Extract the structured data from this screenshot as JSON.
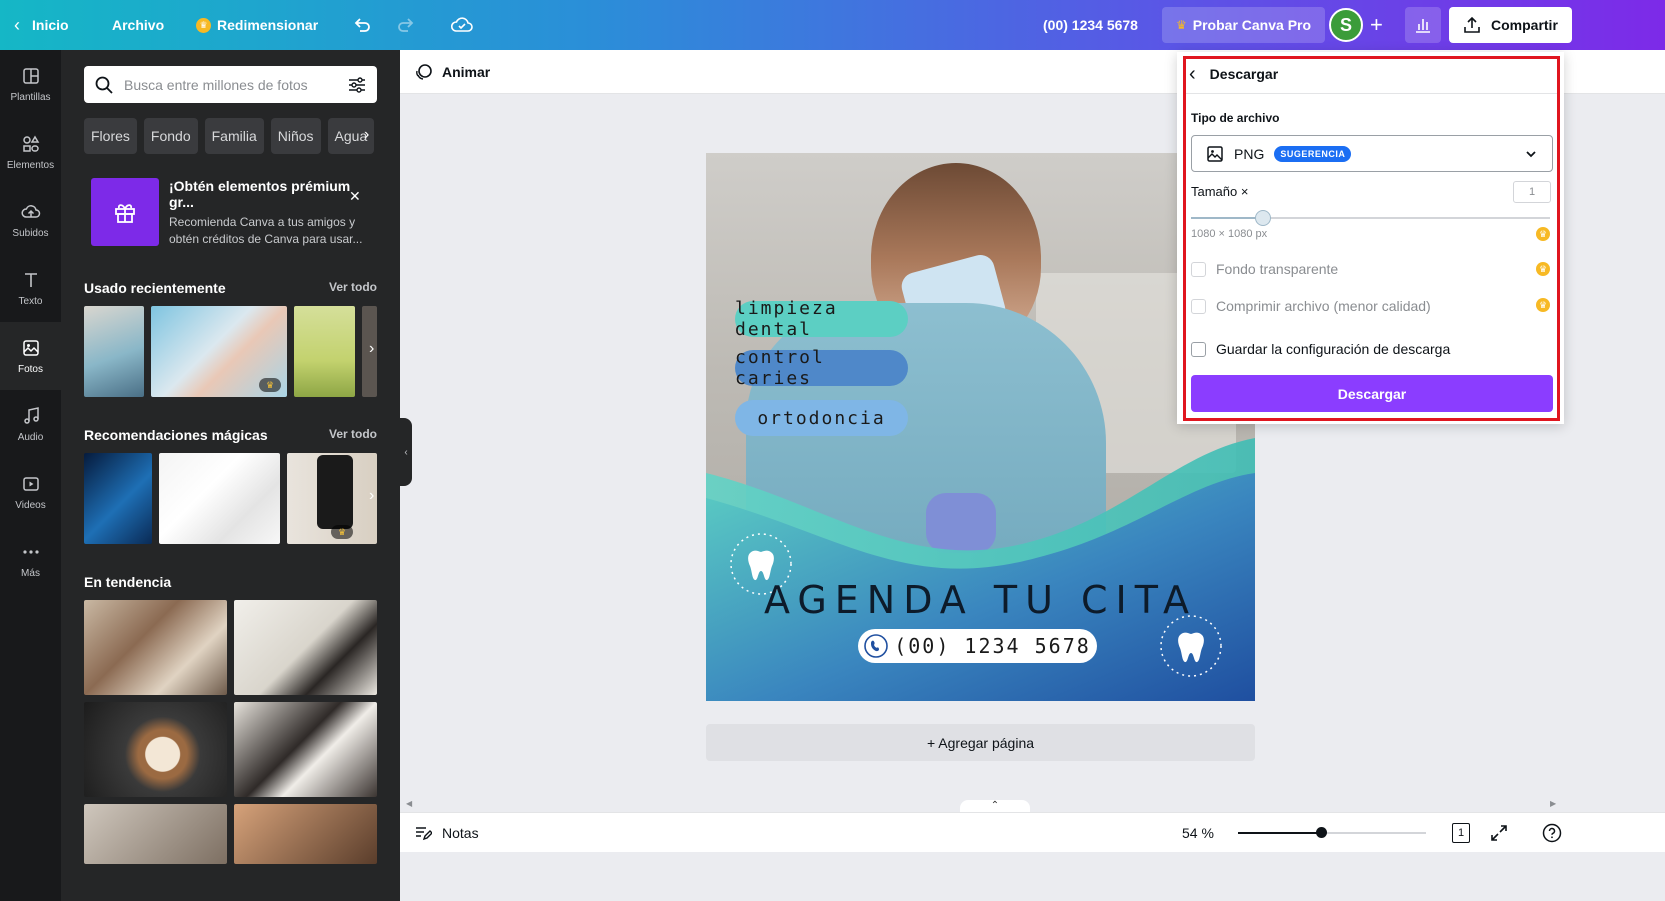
{
  "topbar": {
    "home": "Inicio",
    "file": "Archivo",
    "resize": "Redimensionar",
    "phone": "(00) 1234 5678",
    "try_pro": "Probar Canva Pro",
    "avatar_letter": "S",
    "share": "Compartir",
    "gradient_start": "#15b7c6",
    "gradient_end": "#7d2ae8"
  },
  "rail": {
    "items": [
      {
        "label": "Plantillas",
        "icon": "templates-icon"
      },
      {
        "label": "Elementos",
        "icon": "elements-icon"
      },
      {
        "label": "Subidos",
        "icon": "upload-cloud-icon"
      },
      {
        "label": "Texto",
        "icon": "text-icon"
      },
      {
        "label": "Fotos",
        "icon": "photos-icon"
      },
      {
        "label": "Audio",
        "icon": "music-note-icon"
      },
      {
        "label": "Videos",
        "icon": "video-icon"
      },
      {
        "label": "Más",
        "icon": "more-dots-icon"
      }
    ],
    "active": "Fotos"
  },
  "panel": {
    "search_placeholder": "Busca entre millones de fotos",
    "chips": [
      "Flores",
      "Fondo",
      "Familia",
      "Niños",
      "Agua"
    ],
    "promo_title": "¡Obtén elementos prémium gr...",
    "promo_text": "Recomienda Canva a tus amigos y obtén créditos de Canva para usar...",
    "recent_title": "Usado recientemente",
    "recent_see_all": "Ver todo",
    "magic_title": "Recomendaciones mágicas",
    "magic_see_all": "Ver todo",
    "trending_title": "En tendencia"
  },
  "canvas_toolbar": {
    "animate": "Animar"
  },
  "design": {
    "pills": [
      "limpieza dental",
      "control caries",
      "ortodoncia"
    ],
    "headline": "AGENDA TU CITA",
    "phone": "(00) 1234 5678",
    "colors": {
      "teal": "#5ccfc3",
      "blue": "#1f5fa8",
      "pill_blue": "#4f88c9",
      "pill_light": "#7fb6e6"
    }
  },
  "add_page": "+ Agregar página",
  "bottombar": {
    "notes": "Notas",
    "zoom": "54 %",
    "zoom_fraction": 0.44,
    "page_number": "1"
  },
  "download": {
    "title": "Descargar",
    "file_type_label": "Tipo de archivo",
    "file_type": "PNG",
    "badge": "SUGERENCIA",
    "size_label": "Tamaño ×",
    "size_value": "1",
    "size_fraction": 0.2,
    "dimensions": "1080 × 1080 px",
    "transparent": "Fondo transparente",
    "compress": "Comprimir archivo (menor calidad)",
    "save_settings": "Guardar la configuración de descarga",
    "button": "Descargar",
    "accent": "#8b3dff",
    "highlight": "#e0161f"
  }
}
